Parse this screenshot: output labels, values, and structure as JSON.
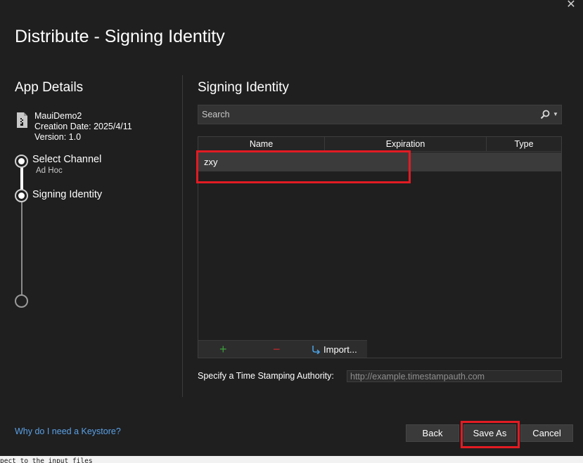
{
  "window": {
    "close_glyph": "✕",
    "title": "Distribute - Signing Identity"
  },
  "app_details": {
    "heading": "App Details",
    "file_icon": "file-zip-icon",
    "name": "MauiDemo2",
    "creation_date": "Creation Date: 2025/4/11",
    "version": "Version: 1.0"
  },
  "steps": [
    {
      "label": "Select Channel",
      "sub": "Ad Hoc",
      "state": "completed"
    },
    {
      "label": "Signing Identity",
      "sub": "",
      "state": "current"
    },
    {
      "label": "",
      "sub": "",
      "state": "pending"
    }
  ],
  "signing": {
    "heading": "Signing Identity",
    "search_placeholder": "Search",
    "columns": [
      "Name",
      "Expiration",
      "Type"
    ],
    "rows": [
      {
        "name": "zxy",
        "expiration": "",
        "type": ""
      }
    ],
    "toolbar": {
      "add_glyph": "+",
      "remove_glyph": "−",
      "import_label": "Import..."
    }
  },
  "tsa": {
    "label": "Specify a Time Stamping Authority:",
    "placeholder": "http://example.timestampauth.com"
  },
  "footer": {
    "help_link": "Why do I need a Keystore?",
    "back_label": "Back",
    "save_as_label": "Save As",
    "cancel_label": "Cancel"
  },
  "status_strip": {
    "text": "pect to the input files"
  },
  "colors": {
    "background": "#1f1f1f",
    "accent_link": "#5aa0e6",
    "highlight_red": "#e21b23",
    "add_green": "#3c9a3c",
    "remove_red": "#c0282c",
    "import_blue": "#4a9fe0"
  }
}
